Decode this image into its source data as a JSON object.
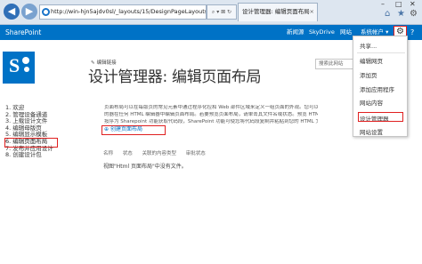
{
  "browser": {
    "address": "http://win-hjn5ajdv0sl/_layouts/15/DesignPageLayouts.aspx",
    "tab_title": "设计管理器: 编辑页面布局"
  },
  "suite": {
    "brand": "SharePoint",
    "links": [
      "新闻源",
      "SkyDrive",
      "网站"
    ],
    "system_account": "系统帐户 ▾",
    "help": "?"
  },
  "page": {
    "edit_links": "编辑链接",
    "title": "设计管理器: 编辑页面布局",
    "search_placeholder": "搜索此网站"
  },
  "left_nav": [
    "1. 欢迎",
    "2. 管理设备通道",
    "3. 上载设计文件",
    "4. 编辑母版页",
    "5. 编辑显示模板",
    "6. 编辑页面布局",
    "7. 发布并应用设计",
    "8. 创建设计包"
  ],
  "description": [
    "页面布局可以在每版页的常见元素中通过程序化控和 Web 部件区域来定义一组页面的外观。您可以使用以下",
    "的器在任何 HTML 编辑器中编辑页面布局。若要预览页面布局，请单击其文件名或状态。预览 HTML 页面",
    "按序为 Sharepoint 功能获取代码段，SharePoint 功能可使您将代码段复制并粘贴到您的 HTML 文件中。"
  ],
  "create_link": "创建页面布局",
  "columns": [
    "名称",
    "状态",
    "关联的内容类型",
    "审批状态"
  ],
  "empty_message": "视图\"Html 页面布局\"中没有文件。",
  "settings_menu": [
    "共享...",
    "编辑网页",
    "添加页",
    "添加应用程序",
    "网站内容",
    "设计管理器",
    "网站设置"
  ],
  "colors": {
    "suite_blue": "#0072c6",
    "highlight_red": "#e02020"
  },
  "icons": {
    "settings": "gear-icon",
    "back": "back-arrow-icon",
    "forward": "forward-arrow-icon",
    "home": "home-icon",
    "favorites": "star-icon",
    "tools": "gear-icon"
  }
}
